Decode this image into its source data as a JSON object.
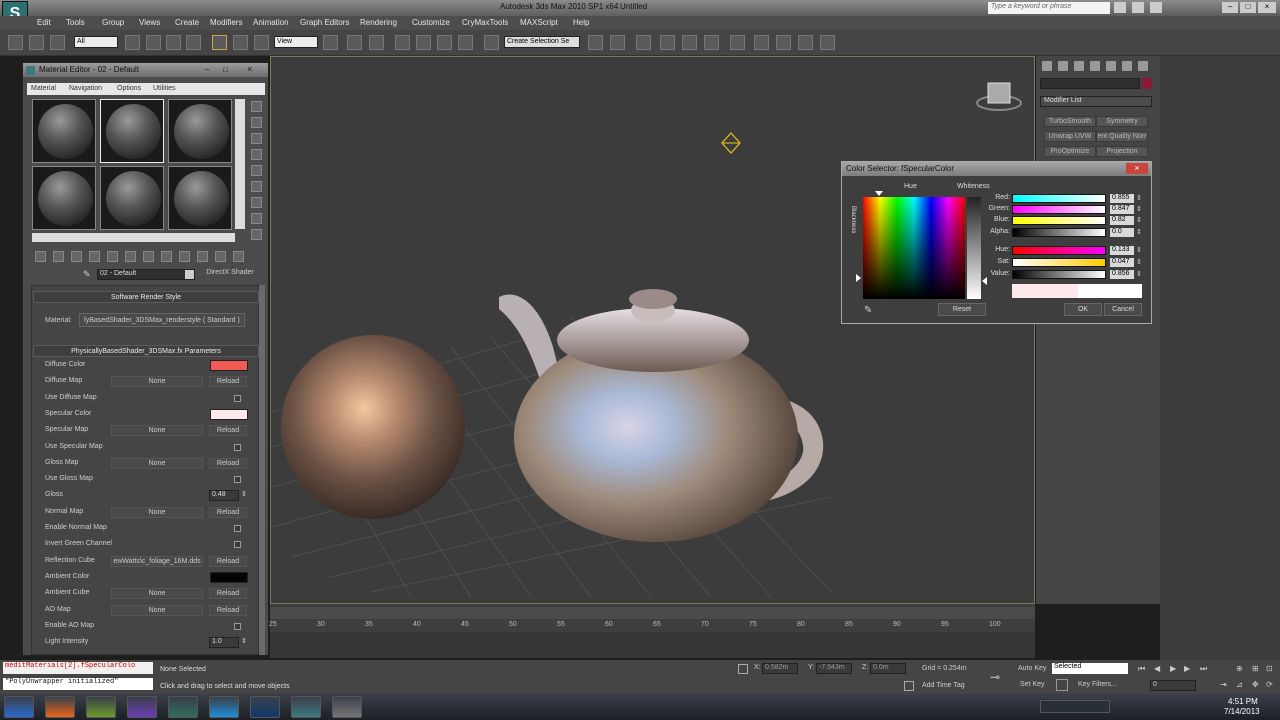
{
  "app": {
    "title": "Autodesk 3ds Max 2010 SP1 x64",
    "file": "Untitled",
    "logo": "3ds-max-logo",
    "search_placeholder": "Type a keyword or phrase"
  },
  "menu": [
    "Edit",
    "Tools",
    "Group",
    "Views",
    "Create",
    "Modifiers",
    "Animation",
    "Graph Editors",
    "Rendering",
    "Customize",
    "CryMaxTools",
    "MAXScript",
    "Help"
  ],
  "toolbar": {
    "filter_value": "All",
    "view_value": "View",
    "selection_set": "Create Selection Se"
  },
  "command_panel": {
    "modifier_list": "Modifier List",
    "buttons": [
      "TurboSmooth",
      "Symmetry",
      "Unwrap UVW",
      "ent Quality Norr",
      "ProOptimize",
      "Projection"
    ]
  },
  "material_editor": {
    "title": "Material Editor - 02 - Default",
    "menus": [
      "Material",
      "Navigation",
      "Options",
      "Utilities"
    ],
    "material_name": "02 - Default",
    "shader_type": "DirectX Shader",
    "rollout_render_style": "Software Render Style",
    "material_label": "Material:",
    "material_value": "lyBasedShader_3DSMax_renderstyle  ( Standard )",
    "rollout_params": "PhysicallyBasedShader_3DSMax.fx Parameters",
    "none_label": "None",
    "reload_label": "Reload",
    "params": [
      {
        "label": "Diffuse Color",
        "type": "color",
        "color": "#f05a55"
      },
      {
        "label": "Diffuse Map",
        "type": "map"
      },
      {
        "label": "Use Diffuse Map",
        "type": "check"
      },
      {
        "label": "Specular Color",
        "type": "color",
        "color": "#fbe9ec"
      },
      {
        "label": "Specular Map",
        "type": "map"
      },
      {
        "label": "Use Specular Map",
        "type": "check"
      },
      {
        "label": "Gloss Map",
        "type": "map"
      },
      {
        "label": "Use Gloss Map",
        "type": "check"
      },
      {
        "label": "Gloss",
        "type": "spinner",
        "value": "0.48"
      },
      {
        "label": "Normal Map",
        "type": "map"
      },
      {
        "label": "Enable Normal Map",
        "type": "check"
      },
      {
        "label": "Invert Green Channel",
        "type": "check"
      },
      {
        "label": "Reflection Cube",
        "type": "map",
        "value": "ewWatts\\c_foliage_16M.dds"
      },
      {
        "label": "Ambient Color",
        "type": "color",
        "color": "#050505"
      },
      {
        "label": "Ambient Cube",
        "type": "map"
      },
      {
        "label": "AO Map",
        "type": "map"
      },
      {
        "label": "Enable AO Map",
        "type": "check"
      },
      {
        "label": "Light Intensity",
        "type": "spinner",
        "value": "1.0"
      }
    ]
  },
  "color_selector": {
    "title": "Color Selector: fSpecularColor",
    "hue_label": "Hue",
    "whiteness_label": "Whiteness",
    "blackness_label": "Blackness",
    "channels": [
      {
        "label": "Red:",
        "value": "0.855",
        "from": "#00ffff",
        "to": "#ffffff"
      },
      {
        "label": "Green:",
        "value": "0.847",
        "from": "#ff00ff",
        "to": "#ffffff"
      },
      {
        "label": "Blue:",
        "value": "0.82",
        "from": "#ffff00",
        "to": "#ffffff"
      },
      {
        "label": "Alpha:",
        "value": "0.0",
        "from": "#000000",
        "to": "#ffffff"
      },
      {
        "label": "Hue:",
        "value": "0.133",
        "from": "#ff0000",
        "to": "#ff00ff"
      },
      {
        "label": "Sat:",
        "value": "0.047",
        "from": "#ffffff",
        "to": "#ffcc00"
      },
      {
        "label": "Value:",
        "value": "0.856",
        "from": "#000000",
        "to": "#ffffff"
      }
    ],
    "reset": "Reset",
    "ok": "OK",
    "cancel": "Cancel",
    "new_color": "#fde9ec",
    "old_color": "#ffffff"
  },
  "timeline": {
    "ticks": [
      "25",
      "30",
      "35",
      "40",
      "45",
      "50",
      "55",
      "60",
      "65",
      "70",
      "75",
      "80",
      "85",
      "90",
      "95",
      "100"
    ]
  },
  "status": {
    "maxscript_line1": "meditMaterials[2].fSpecularColo",
    "maxscript_line2": "\"PolyUnwrapper initialized\"",
    "selection": "None Selected",
    "prompt": "Click and drag to select and move objects",
    "x_label": "X:",
    "x_value": "0.582m",
    "y_label": "Y:",
    "y_value": "-7.943m",
    "z_label": "Z:",
    "z_value": "0.0m",
    "grid": "Grid = 0.254m",
    "add_time_tag": "Add Time Tag",
    "auto_key": "Auto Key",
    "set_key": "Set Key",
    "selected_value": "Selected",
    "key_filters": "Key Filters...",
    "frame_value": "0"
  },
  "taskbar": {
    "time": "4:51 PM",
    "date": "7/14/2013",
    "apps": [
      "windows-start-icon",
      "firefox-icon",
      "notepad-icon",
      "visual-studio-icon",
      "explorer-icon",
      "skype-icon",
      "photoshop-icon",
      "3dsmax-taskbar-icon",
      "lock-app-icon"
    ]
  }
}
